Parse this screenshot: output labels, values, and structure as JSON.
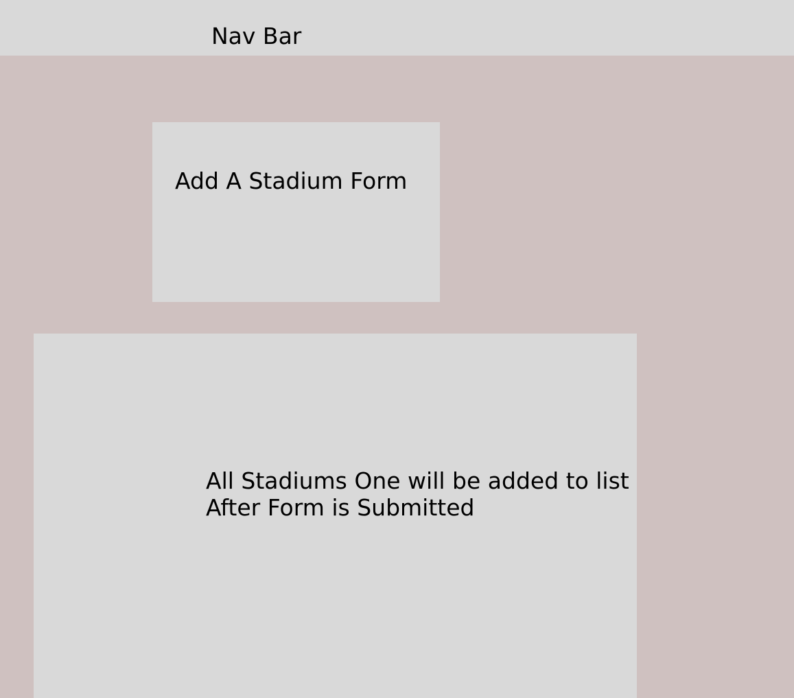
{
  "nav": {
    "label": "Nav Bar"
  },
  "form_panel": {
    "label": "Add A Stadium Form"
  },
  "list_panel": {
    "line1": "All Stadiums One will be added to list",
    "line2": "After Form is Submitted"
  },
  "colors": {
    "page_background": "#cfc1c0",
    "panel_background": "#d9d9d9",
    "text": "#000000"
  }
}
